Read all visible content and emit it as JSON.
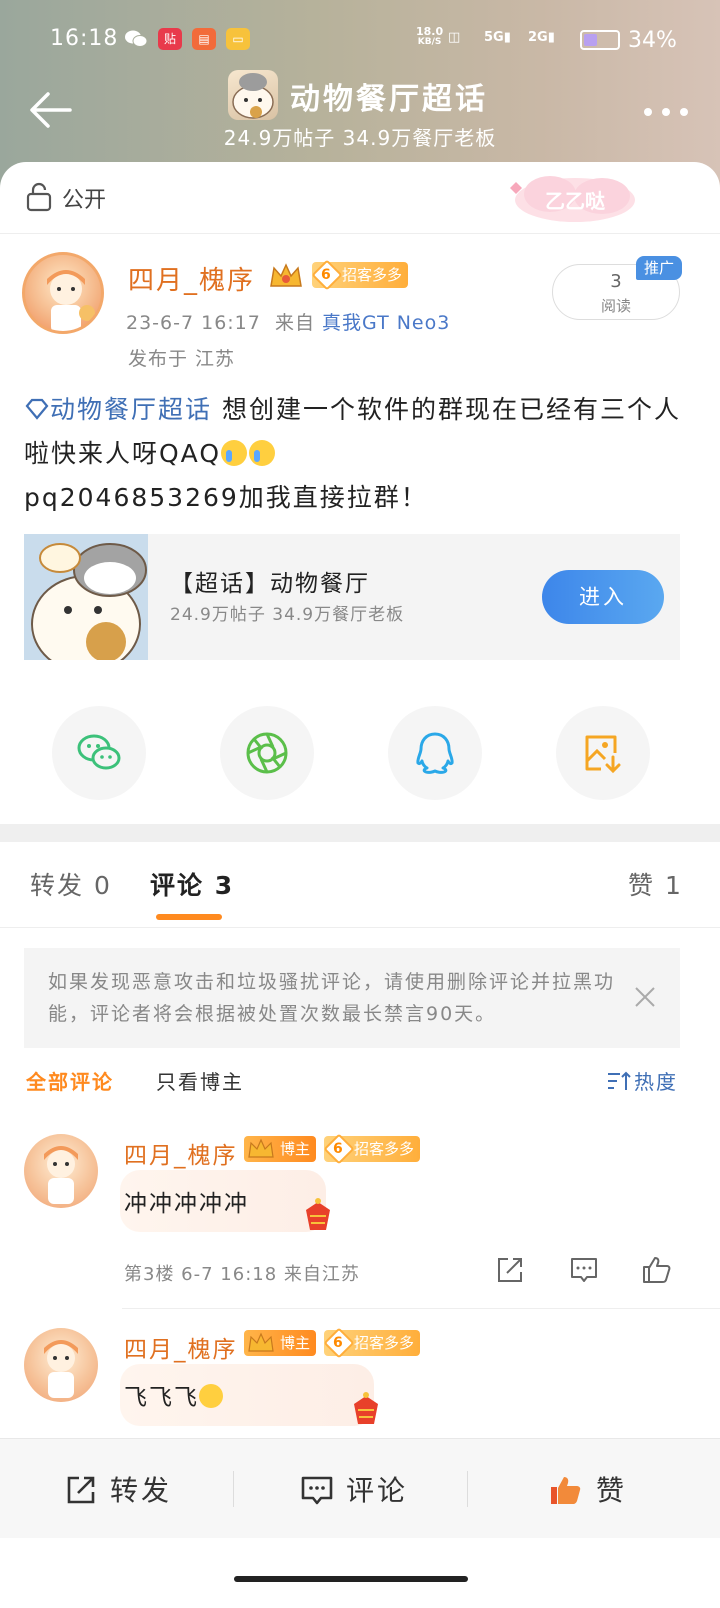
{
  "status_bar": {
    "time": "16:18",
    "net_speed_top": "18.0",
    "net_speed_unit": "KB/S",
    "sig1": "5G",
    "sig2": "2G",
    "battery": "34%"
  },
  "header": {
    "title": "动物餐厅超话",
    "subtitle": "24.9万帖子 34.9万餐厅老板"
  },
  "visibility": {
    "label": "公开",
    "deco_text": "乙乙哒"
  },
  "post": {
    "author": "四月_槐序",
    "level": "6",
    "level_badge": "招客多多",
    "time": "23-6-7 16:17",
    "from_label": "来自",
    "device": "真我GT Neo3",
    "location": "发布于 江苏",
    "read_count": "3",
    "read_label": "阅读",
    "promo_tag": "推广",
    "topic_tag": "动物餐厅超话",
    "text_1": "想创建一个软件的群现在已经有三个人啦快来人呀QAQ",
    "text_2": "pq2046853269加我直接拉群！"
  },
  "topic_card": {
    "title": "【超话】动物餐厅",
    "subtitle": "24.9万帖子 34.9万餐厅老板",
    "enter_label": "进入"
  },
  "share": {
    "items": [
      "wechat-icon",
      "moments-icon",
      "qq-icon",
      "save-image-icon"
    ],
    "colors": [
      "#3cc17a",
      "#5bbf4a",
      "#2aa8e8",
      "#f5a623"
    ]
  },
  "tabs": {
    "repost": "转发 0",
    "comments": "评论 3",
    "likes": "赞 1"
  },
  "notice": {
    "text": "如果发现恶意攻击和垃圾骚扰评论，请使用删除评论并拉黑功能，评论者将会根据被处置次数最长禁言90天。"
  },
  "filters": {
    "all": "全部评论",
    "owner_only": "只看博主",
    "sort": "热度"
  },
  "comments": [
    {
      "name": "四月_槐序",
      "owner_badge": "博主",
      "level": "6",
      "level_badge": "招客多多",
      "text": "冲冲冲冲冲",
      "meta": "第3楼 6-7 16:18 来自江苏"
    },
    {
      "name": "四月_槐序",
      "owner_badge": "博主",
      "level": "6",
      "level_badge": "招客多多",
      "text": "飞飞飞"
    }
  ],
  "bottom_bar": {
    "repost": "转发",
    "comment": "评论",
    "like": "赞"
  },
  "colors": {
    "accent_orange": "#ff8a1f",
    "link_blue": "#3f6fb5",
    "enter_blue": "#3d86ea"
  }
}
